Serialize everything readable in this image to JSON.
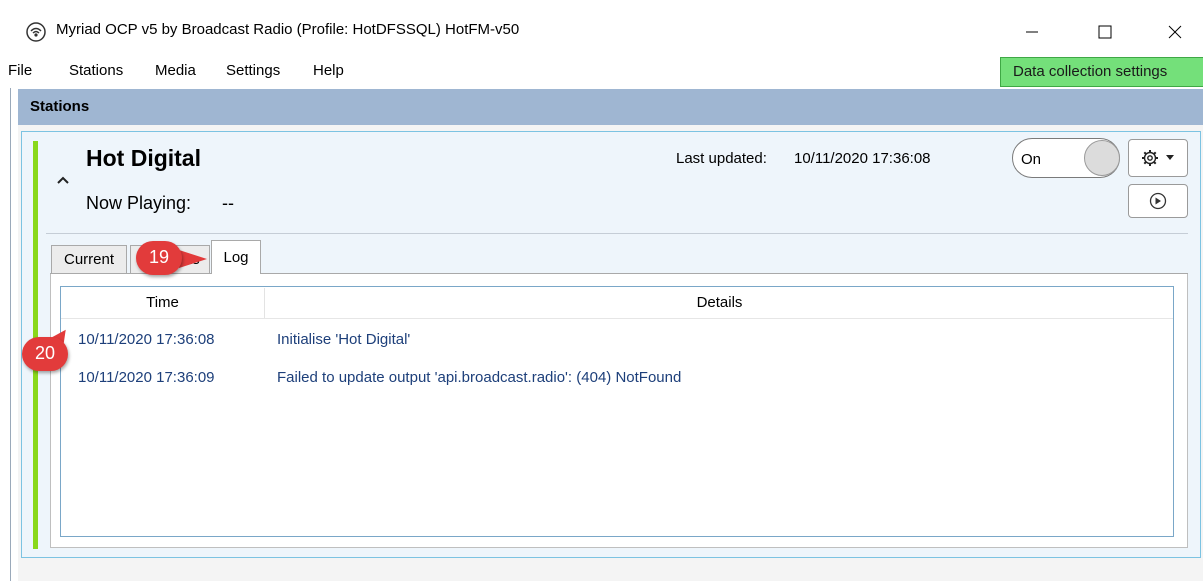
{
  "window": {
    "title": "Myriad OCP v5 by Broadcast Radio (Profile: HotDFSSQL) HotFM-v50",
    "minimize_label": "—",
    "maximize_label": "☐",
    "close_label": "✕"
  },
  "menu": {
    "items": [
      "File",
      "Stations",
      "Media",
      "Settings",
      "Help"
    ],
    "data_collection_label": "Data collection settings",
    "data_collection_color": "#74e07a"
  },
  "stations_panel": {
    "title": "Stations"
  },
  "station": {
    "name": "Hot Digital",
    "now_playing_label": "Now Playing:",
    "now_playing_value": "--",
    "last_updated_label": "Last updated:",
    "last_updated_value": "10/11/2020 17:36:08",
    "toggle_label": "On",
    "accent_color": "#8ad81b",
    "gear_icon": "gear-icon",
    "nav_icon": "arrow-circle-right-icon"
  },
  "tabs": [
    {
      "label": "Current"
    },
    {
      "label": "ts"
    },
    {
      "label": "Log",
      "active": true
    }
  ],
  "log": {
    "columns": [
      "Time",
      "Details"
    ],
    "rows": [
      {
        "time": "10/11/2020 17:36:08",
        "details": "Initialise 'Hot Digital'"
      },
      {
        "time": "10/11/2020 17:36:09",
        "details": "Failed to update output 'api.broadcast.radio': (404) NotFound"
      }
    ]
  },
  "callouts": [
    {
      "label": "19"
    },
    {
      "label": "20"
    }
  ]
}
